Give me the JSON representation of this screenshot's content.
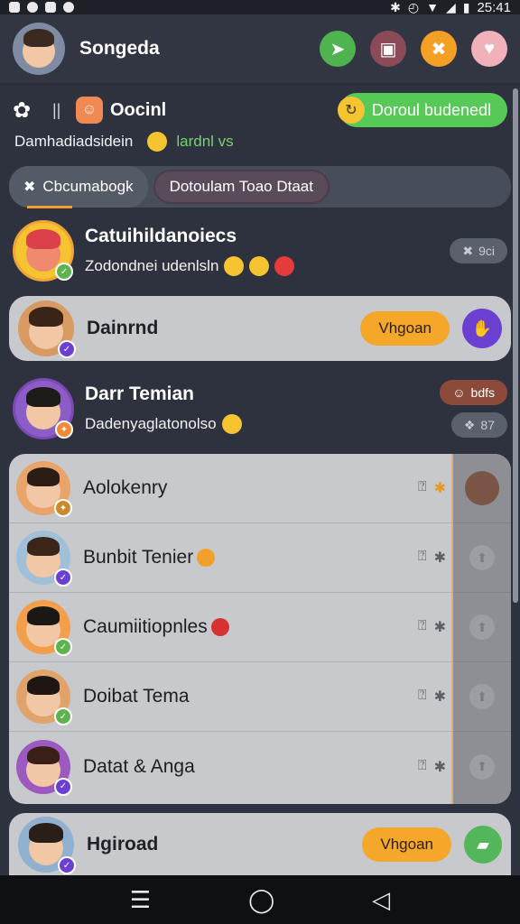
{
  "status_bar": {
    "time": "25:41",
    "left_icons": [
      "app-icon",
      "app-icon",
      "app-icon",
      "app-icon"
    ],
    "right_icons": [
      "bluetooth-icon",
      "alarm-icon",
      "wifi-icon",
      "signal-icon",
      "battery-icon"
    ]
  },
  "header": {
    "title": "Songeda",
    "buttons": [
      {
        "name": "send-button",
        "icon": "paper-plane-icon",
        "color": "#4fb44f",
        "glyph": "➤"
      },
      {
        "name": "gallery-button",
        "icon": "photo-icon",
        "color": "#8a4a58",
        "glyph": "▣"
      },
      {
        "name": "tools-button",
        "icon": "cross-tools-icon",
        "color": "#f3a024",
        "glyph": "✖"
      },
      {
        "name": "cat-button",
        "icon": "cat-icon",
        "color": "#f1b1ba",
        "glyph": "♥"
      }
    ]
  },
  "info": {
    "label": "Oocinl",
    "sub_text": "Damhadiadsidein",
    "sub_green": "lardnl vs",
    "action_pill": "Doroul budenedl"
  },
  "tabs": {
    "tab1": "Cbcumabogk",
    "tab2": "Dotoulam Toao Dtaat"
  },
  "chats": {
    "top": {
      "name": "Catuihildanoiecs",
      "sub": "Zodondnei udenlsln",
      "pill": "9ci"
    },
    "second": {
      "name": "Dainrnd",
      "action": "Vhgoan"
    },
    "third": {
      "name": "Darr Temian",
      "sub": "Dadenyaglatonolso",
      "tag_top": "bdfs",
      "tag_bottom": "87"
    }
  },
  "list": [
    {
      "name": "Aolokenry"
    },
    {
      "name": "Bunbit Tenier"
    },
    {
      "name": "Caumiitiopnles"
    },
    {
      "name": "Doibat Tema"
    },
    {
      "name": "Datat & Anga"
    }
  ],
  "bottom": {
    "name": "Hgiroad",
    "action": "Vhgoan"
  },
  "colors": {
    "accent_orange": "#f5a72a",
    "accent_green": "#57c957",
    "accent_purple": "#6a3fd1"
  }
}
